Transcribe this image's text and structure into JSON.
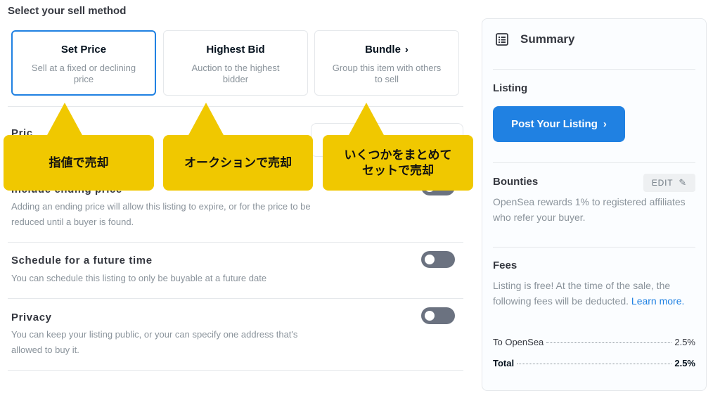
{
  "page": {
    "heading": "Select your sell method"
  },
  "methods": [
    {
      "title": "Set Price",
      "desc": "Sell at a fixed or declining price",
      "selected": true
    },
    {
      "title": "Highest Bid",
      "desc": "Auction to the highest bidder",
      "selected": false
    },
    {
      "title": "Bundle",
      "desc": "Group this item with others to sell",
      "selected": false,
      "chevron": "›"
    }
  ],
  "sections": {
    "price": {
      "title_partial": "Pric"
    },
    "ending_price": {
      "title_partial": "Include ending price",
      "desc": "Adding an ending price will allow this listing to expire, or for the price to be reduced until a buyer is found."
    },
    "schedule": {
      "title": "Schedule for a future time",
      "desc": "You can schedule this listing to only be buyable at a future date"
    },
    "privacy": {
      "title": "Privacy",
      "desc": "You can keep your listing public, or your can specify one address that's allowed to buy it."
    }
  },
  "callouts": {
    "set_price": "指値で売却",
    "highest_bid": "オークションで売却",
    "bundle_line1": "いくつかをまとめて",
    "bundle_line2": "セットで売却",
    "color": "#f0c800"
  },
  "summary": {
    "title": "Summary",
    "icon": "list-icon",
    "listing_heading": "Listing",
    "post_button": "Post Your Listing",
    "bounties_heading": "Bounties",
    "edit_label": "EDIT",
    "bounties_desc": "OpenSea rewards 1% to registered affiliates who refer your buyer.",
    "fees_heading": "Fees",
    "fees_desc": "Listing is free! At the time of the sale, the following fees will be deducted.",
    "learn_more": "Learn more.",
    "fee_rows": [
      {
        "label": "To OpenSea",
        "value": "2.5%"
      },
      {
        "label": "Total",
        "value": "2.5%"
      }
    ]
  },
  "colors": {
    "accent": "#2081e2",
    "toggle_off": "#6b7280"
  }
}
